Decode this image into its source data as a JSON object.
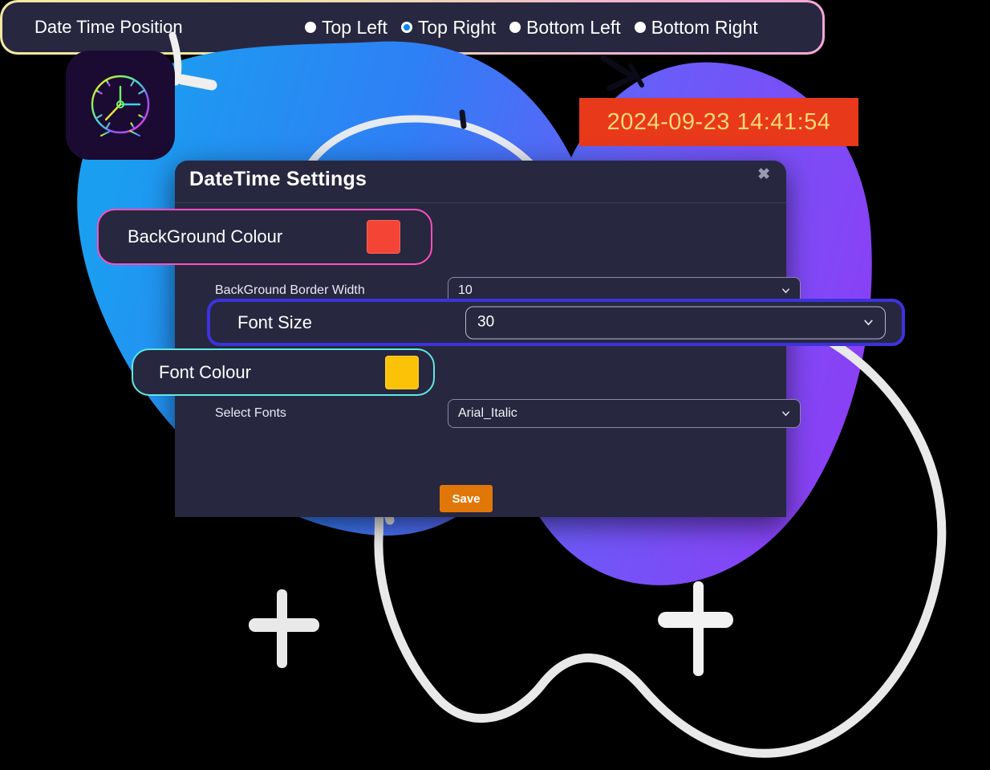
{
  "timestamp_badge": {
    "text": "2024-09-23 14:41:54",
    "background_color": "#e8391b",
    "text_color": "#ffd873"
  },
  "app_icon": {
    "name": "clock-icon",
    "tile_color": "#1b0b33"
  },
  "dialog": {
    "title": "DateTime Settings",
    "close_label": "✖",
    "background_color": "#272740",
    "rows": {
      "background_colour": {
        "label": "BackGround Colour",
        "swatch_color": "#f44436",
        "highlight_border": "#ff4fbe"
      },
      "background_border_width": {
        "label": "BackGround Border Width",
        "value": "10"
      },
      "font_size": {
        "label": "Font Size",
        "value": "30",
        "highlight_border": "#3c33dd"
      },
      "font_colour": {
        "label": "Font Colour",
        "swatch_color": "#fcc208",
        "highlight_border": "#5fe8e0"
      },
      "select_fonts": {
        "label": "Select Fonts",
        "value": "Arial_Italic"
      },
      "date_time_position": {
        "label": "Date Time Position",
        "options": [
          {
            "label": "Top Left",
            "checked": false
          },
          {
            "label": "Top Right",
            "checked": true
          },
          {
            "label": "Bottom Left",
            "checked": false
          },
          {
            "label": "Bottom Right",
            "checked": false
          }
        ]
      }
    },
    "save_label": "Save",
    "save_color": "#e07708"
  }
}
